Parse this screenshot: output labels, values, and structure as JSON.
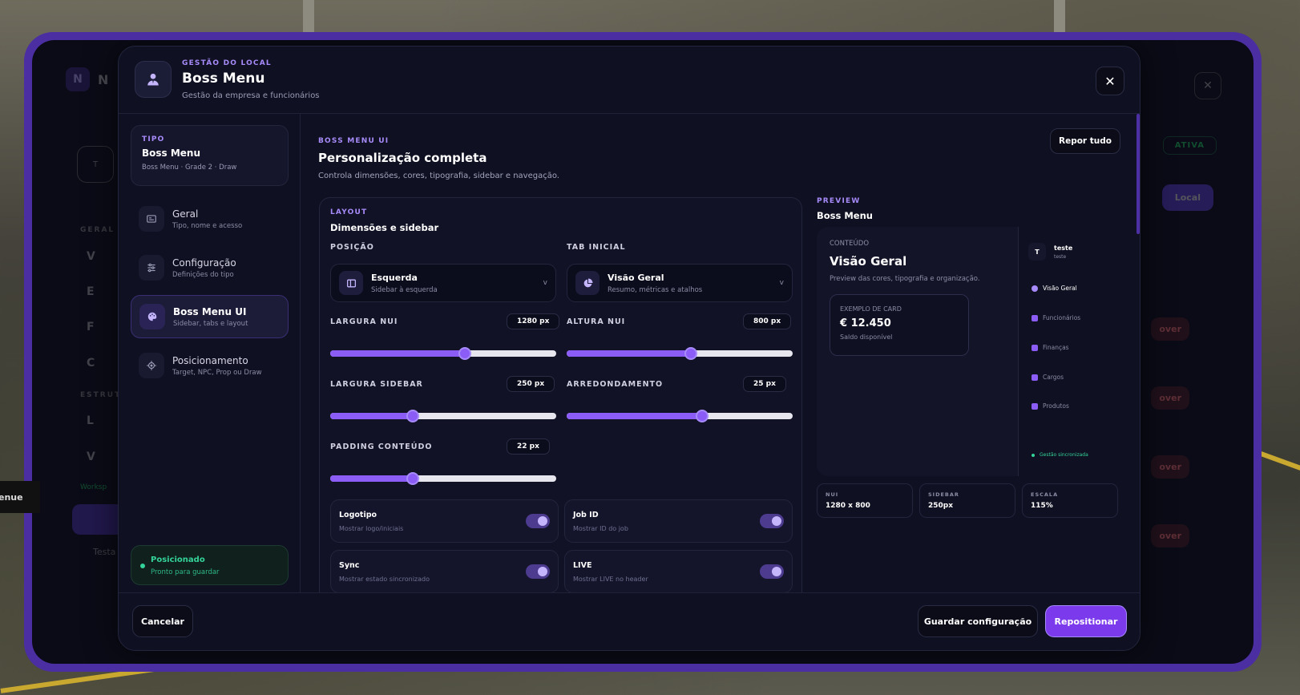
{
  "background_app": {
    "logo_letter": "N",
    "logo_text": "N",
    "avatar_letter": "T",
    "section_geral": "GERAL",
    "section_estrut": "ESTRUT",
    "items": [
      "V",
      "E",
      "F",
      "C",
      "L",
      "V"
    ],
    "workspace_text": "Worksp",
    "test_text": "Testa",
    "ativa_badge": "ATIVA",
    "local_button": "Local",
    "over_buttons": [
      "over",
      "over",
      "over",
      "over"
    ],
    "left_edge_label": "enue",
    "close_glyph": "✕"
  },
  "header": {
    "eyebrow": "GESTÃO DO LOCAL",
    "title": "Boss Menu",
    "subtitle": "Gestão da empresa e funcionários",
    "close_glyph": "✕"
  },
  "sidebar": {
    "tipo": {
      "label": "TIPO",
      "title": "Boss Menu",
      "subtitle": "Boss Menu · Grade 2 · Draw"
    },
    "items": [
      {
        "label": "Geral",
        "sub": "Tipo, nome e acesso",
        "icon": "id-card-icon"
      },
      {
        "label": "Configuração",
        "sub": "Definições do tipo",
        "icon": "sliders-icon"
      },
      {
        "label": "Boss Menu UI",
        "sub": "Sidebar, tabs e layout",
        "icon": "palette-icon"
      },
      {
        "label": "Posicionamento",
        "sub": "Target, NPC, Prop ou Draw",
        "icon": "crosshair-icon"
      }
    ],
    "status": {
      "title": "Posicionado",
      "sub": "Pronto para guardar"
    }
  },
  "content": {
    "eyebrow": "BOSS MENU UI",
    "title": "Personalização completa",
    "subtitle": "Controla dimensões, cores, tipografia, sidebar e navegação.",
    "reset_label": "Repor tudo",
    "layout": {
      "eyebrow": "LAYOUT",
      "title": "Dimensões e sidebar",
      "posicao": {
        "label": "POSIÇÃO",
        "value": "Esquerda",
        "sub": "Sidebar à esquerda",
        "chevron": "v"
      },
      "tab_inicial": {
        "label": "TAB INICIAL",
        "value": "Visão Geral",
        "sub": "Resumo, métricas e atalhos",
        "chevron": "v"
      },
      "sliders": [
        {
          "label": "LARGURA NUI",
          "value_text": "1280 px",
          "fraction": 0.595
        },
        {
          "label": "ALTURA NUI",
          "value_text": "800 px",
          "fraction": 0.55
        },
        {
          "label": "LARGURA SIDEBAR",
          "value_text": "250 px",
          "fraction": 0.365
        },
        {
          "label": "ARREDONDAMENTO",
          "value_text": "25 px",
          "fraction": 0.6
        },
        {
          "label": "PADDING CONTEÚDO",
          "value_text": "22 px",
          "fraction": 0.365
        }
      ],
      "toggles": [
        {
          "title": "Logotipo",
          "sub": "Mostrar logo/iniciais",
          "on": true
        },
        {
          "title": "Job ID",
          "sub": "Mostrar ID do job",
          "on": true
        },
        {
          "title": "Sync",
          "sub": "Mostrar estado sincronizado",
          "on": true
        },
        {
          "title": "LIVE",
          "sub": "Mostrar LIVE no header",
          "on": true
        }
      ]
    },
    "preview": {
      "eyebrow": "PREVIEW",
      "title": "Boss Menu",
      "content_label": "CONTEÚDO",
      "main_title": "Visão Geral",
      "main_sub": "Preview das cores, tipografia e organização.",
      "card_label": "EXEMPLO DE CARD",
      "card_value": "€ 12.450",
      "card_sub": "Saldo disponível",
      "avatar_letter": "T",
      "user_name": "teste",
      "user_sub": "teste",
      "nav": [
        "Visão Geral",
        "Funcionários",
        "Finanças",
        "Cargos",
        "Produtos"
      ],
      "sync_text": "Gestão sincronizada"
    },
    "stats": [
      {
        "label": "NUI",
        "value": "1280 x 800"
      },
      {
        "label": "SIDEBAR",
        "value": "250px"
      },
      {
        "label": "ESCALA",
        "value": "115%"
      }
    ]
  },
  "footer": {
    "cancel_label": "Cancelar",
    "save_label": "Guardar configuração",
    "reposition_label": "Repositionar"
  },
  "colors": {
    "accent": "#8b5cf6",
    "accent_light": "#a78bfa",
    "frame": "#4b2ea2",
    "success": "#34d399",
    "panel": "#0f1021"
  }
}
